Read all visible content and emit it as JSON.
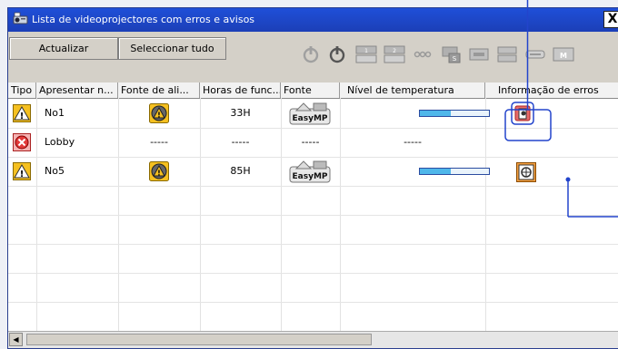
{
  "window": {
    "title": "Lista de videoprojectores com erros e avisos",
    "close_label": "X"
  },
  "toolbar": {
    "refresh_label": "Actualizar",
    "select_all_label": "Seleccionar tudo",
    "icons": [
      "power-on-icon",
      "power-standby-icon",
      "input-computer1-icon",
      "input-computer2-icon",
      "input-video-icon",
      "input-svideo-icon",
      "input-hdmi-icon",
      "input-dvi-icon",
      "input-usb-icon",
      "input-network-icon"
    ]
  },
  "table": {
    "headers": [
      "Tipo",
      "Apresentar n...",
      "Fonte de ali...",
      "Horas de func...",
      "Fonte",
      "Nível de temperatura",
      "Informação de erros"
    ],
    "rows": [
      {
        "type": "warning",
        "name": "No1",
        "power": "warning",
        "hours": "33H",
        "source": "EasyMP",
        "temperature": 0.45,
        "error_info": "lamp-cover-error"
      },
      {
        "type": "error",
        "name": "Lobby",
        "power": "-----",
        "hours": "-----",
        "source": "-----",
        "temperature": "-----",
        "error_info": ""
      },
      {
        "type": "warning",
        "name": "No5",
        "power": "warning",
        "hours": "85H",
        "source": "EasyMP",
        "temperature": 0.45,
        "error_info": "fan-error"
      }
    ]
  },
  "colors": {
    "titlebar": "#1f4fd8",
    "highlight": "#2244cc",
    "warning_yellow": "#f5c020",
    "error_red": "#e23a3a",
    "temp_fill": "#4fb7ea"
  }
}
